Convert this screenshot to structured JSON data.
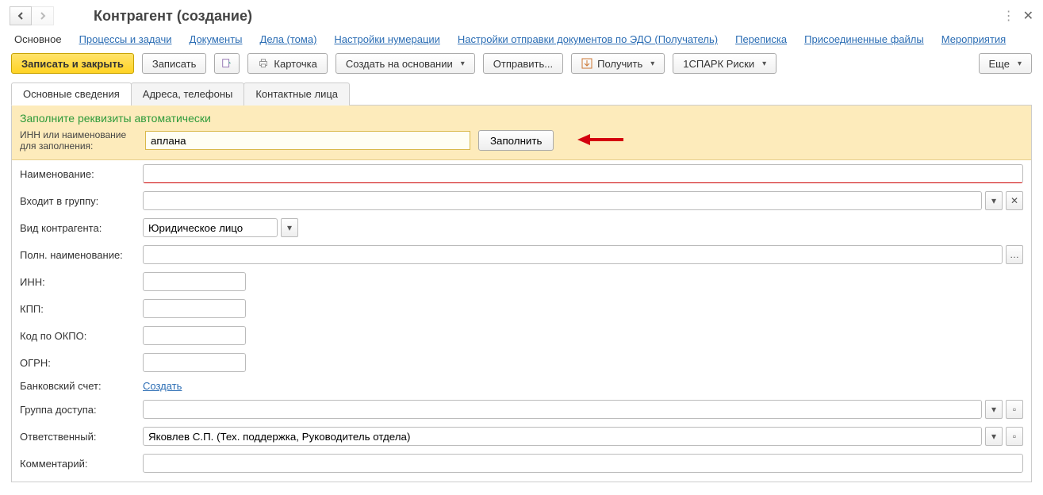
{
  "header": {
    "title": "Контрагент (создание)"
  },
  "nav": {
    "current": "Основное",
    "links": [
      "Процессы и задачи",
      "Документы",
      "Дела (тома)",
      "Настройки нумерации",
      "Настройки отправки документов по ЭДО (Получатель)",
      "Переписка",
      "Присоединенные файлы",
      "Мероприятия"
    ]
  },
  "toolbar": {
    "save_close": "Записать и закрыть",
    "save": "Записать",
    "card": "Карточка",
    "create_based": "Создать на основании",
    "send": "Отправить...",
    "receive": "Получить",
    "spark": "1СПАРК Риски",
    "more": "Еще"
  },
  "tabs": [
    "Основные сведения",
    "Адреса, телефоны",
    "Контактные лица"
  ],
  "autofill": {
    "title": "Заполните реквизиты автоматически",
    "label": "ИНН или наименование для заполнения:",
    "value": "аплана",
    "button": "Заполнить"
  },
  "fields": {
    "name_label": "Наименование:",
    "name_value": "",
    "group_label": "Входит в группу:",
    "group_value": "",
    "type_label": "Вид контрагента:",
    "type_value": "Юридическое лицо",
    "fullname_label": "Полн. наименование:",
    "fullname_value": "",
    "inn_label": "ИНН:",
    "inn_value": "",
    "kpp_label": "КПП:",
    "kpp_value": "",
    "okpo_label": "Код по ОКПО:",
    "okpo_value": "",
    "ogrn_label": "ОГРН:",
    "ogrn_value": "",
    "bank_label": "Банковский счет:",
    "bank_link": "Создать",
    "access_label": "Группа доступа:",
    "access_value": "",
    "responsible_label": "Ответственный:",
    "responsible_value": "Яковлев С.П. (Тех. поддержка, Руководитель отдела)",
    "comment_label": "Комментарий:",
    "comment_value": ""
  }
}
